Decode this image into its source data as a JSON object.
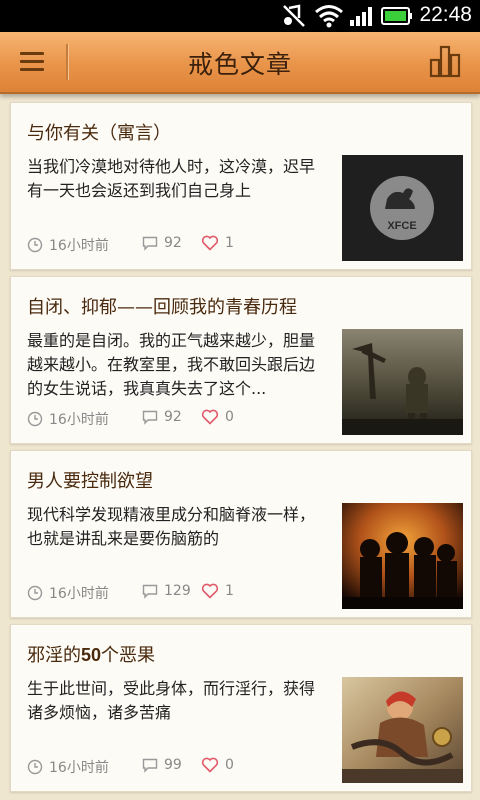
{
  "status_bar": {
    "time": "22:48"
  },
  "app_bar": {
    "title": "戒色文章"
  },
  "articles": [
    {
      "title": "与你有关（寓言）",
      "summary": "当我们冷漠地对待他人时，这冷漠，迟早有一天也会返还到我们自己身上",
      "time": "16小时前",
      "comments": "92",
      "likes": "1",
      "thumb_text": "XFCE"
    },
    {
      "title": "自闭、抑郁——回顾我的青春历程",
      "summary": "最重的是自闭。我的正气越来越少，胆量越来越小。在教室里，我不敢回头跟后边的女生说话，我真真失去了这个...",
      "time": "16小时前",
      "comments": "92",
      "likes": "0"
    },
    {
      "title": "男人要控制欲望",
      "summary": "现代科学发现精液里成分和脑脊液一样，也就是讲乱来是要伤脑筋的",
      "time": "16小时前",
      "comments": "129",
      "likes": "1"
    },
    {
      "title_prefix": "邪淫的",
      "title_number": "50",
      "title_suffix": "个恶果",
      "summary": "生于此世间，受此身体，而行淫行，获得诸多烦恼，诸多苦痛",
      "time": "16小时前",
      "comments": "99",
      "likes": "0"
    }
  ],
  "colors": {
    "app_bar": "#e9944a",
    "title_text": "#4a2a0e",
    "like_icon": "#e05a6a",
    "background": "#efe6d0"
  }
}
